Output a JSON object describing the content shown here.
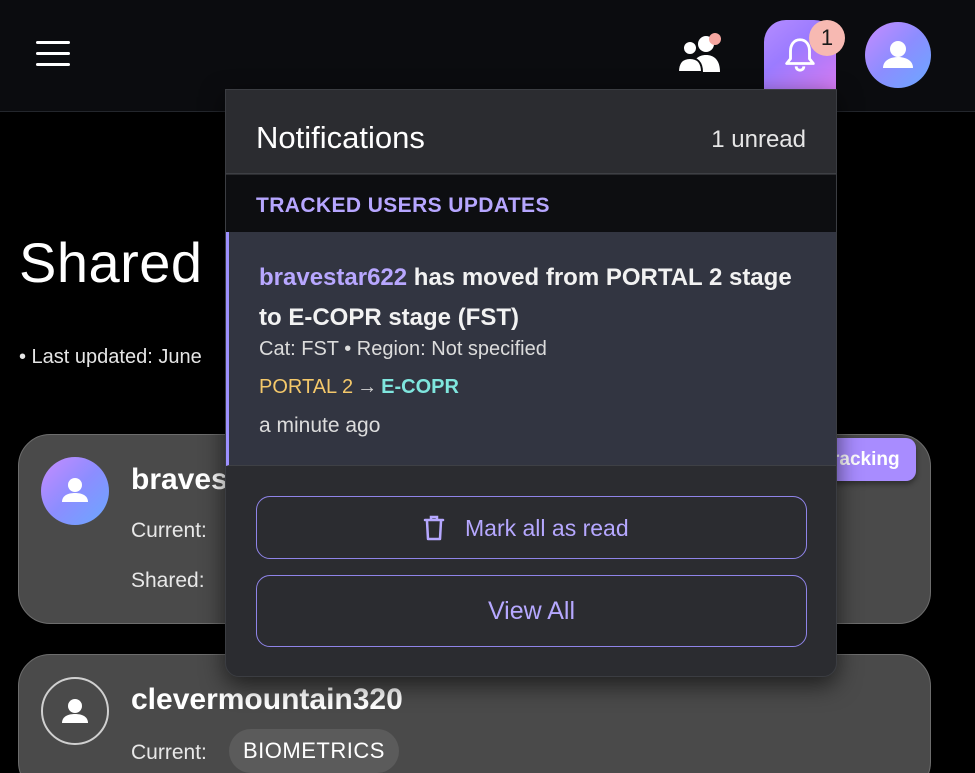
{
  "header": {
    "menu_icon": "hamburger-menu-icon",
    "people_icon": "people-icon",
    "bell_icon": "bell-icon",
    "notification_badge": "1",
    "profile_icon": "user-icon"
  },
  "page": {
    "title": "Shared",
    "last_updated": "• Last updated: June"
  },
  "cards": [
    {
      "name": "braves",
      "current_label": "Current:",
      "shared_label": "Shared:",
      "tracking_label": "racking"
    },
    {
      "name": "clevermountain320",
      "current_label": "Current:",
      "current_value": "BIOMETRICS"
    }
  ],
  "notifications": {
    "title": "Notifications",
    "unread": "1 unread",
    "section_title": "TRACKED USERS UPDATES",
    "items": [
      {
        "user": "bravestar622",
        "message": " has moved from PORTAL 2 stage to E-COPR stage (FST)",
        "meta": "Cat: FST • Region: Not specified",
        "from_stage": "PORTAL 2",
        "arrow": "→",
        "to_stage": "E-COPR",
        "time": "a minute ago"
      }
    ],
    "mark_all_label": "Mark all as read",
    "view_all_label": "View All"
  },
  "colors": {
    "accent": "#b6a8ff",
    "badge": "#f7b9b2",
    "stage_from": "#f4c86a",
    "stage_to": "#7fe6de"
  }
}
